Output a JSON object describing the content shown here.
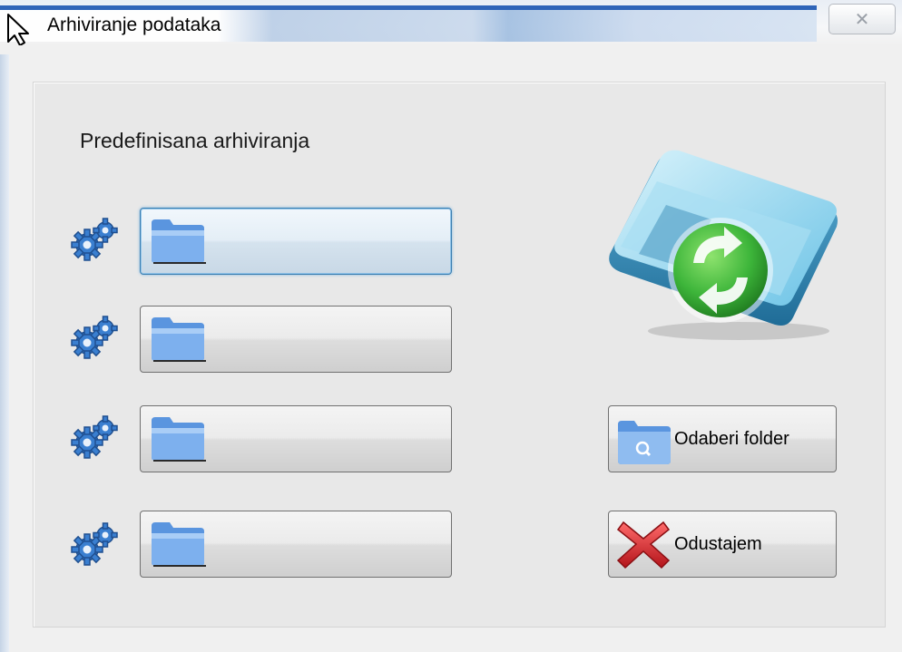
{
  "window": {
    "title": "Arhiviranje podataka",
    "close_glyph": "✕"
  },
  "section": {
    "label": "Predefinisana arhiviranja"
  },
  "archive_slots": [
    {
      "label": "",
      "icon": "folder-icon",
      "settings_icon": "gears-icon",
      "focused": true
    },
    {
      "label": "",
      "icon": "folder-icon",
      "settings_icon": "gears-icon",
      "focused": false
    },
    {
      "label": "",
      "icon": "folder-icon",
      "settings_icon": "gears-icon",
      "focused": false
    },
    {
      "label": "",
      "icon": "folder-icon",
      "settings_icon": "gears-icon",
      "focused": false
    }
  ],
  "buttons": {
    "browse_label": "Odaberi folder",
    "browse_icon": "folder-search-icon",
    "cancel_label": "Odustajem",
    "cancel_icon": "red-x-icon"
  },
  "illustration": {
    "icon": "archive-sync-icon"
  },
  "colors": {
    "title_accent": "#2f64b8",
    "folder_blue": "#4a86d8",
    "sync_green": "#3db53a",
    "cancel_red": "#d6262a",
    "focus_border": "#3c7fb1"
  }
}
